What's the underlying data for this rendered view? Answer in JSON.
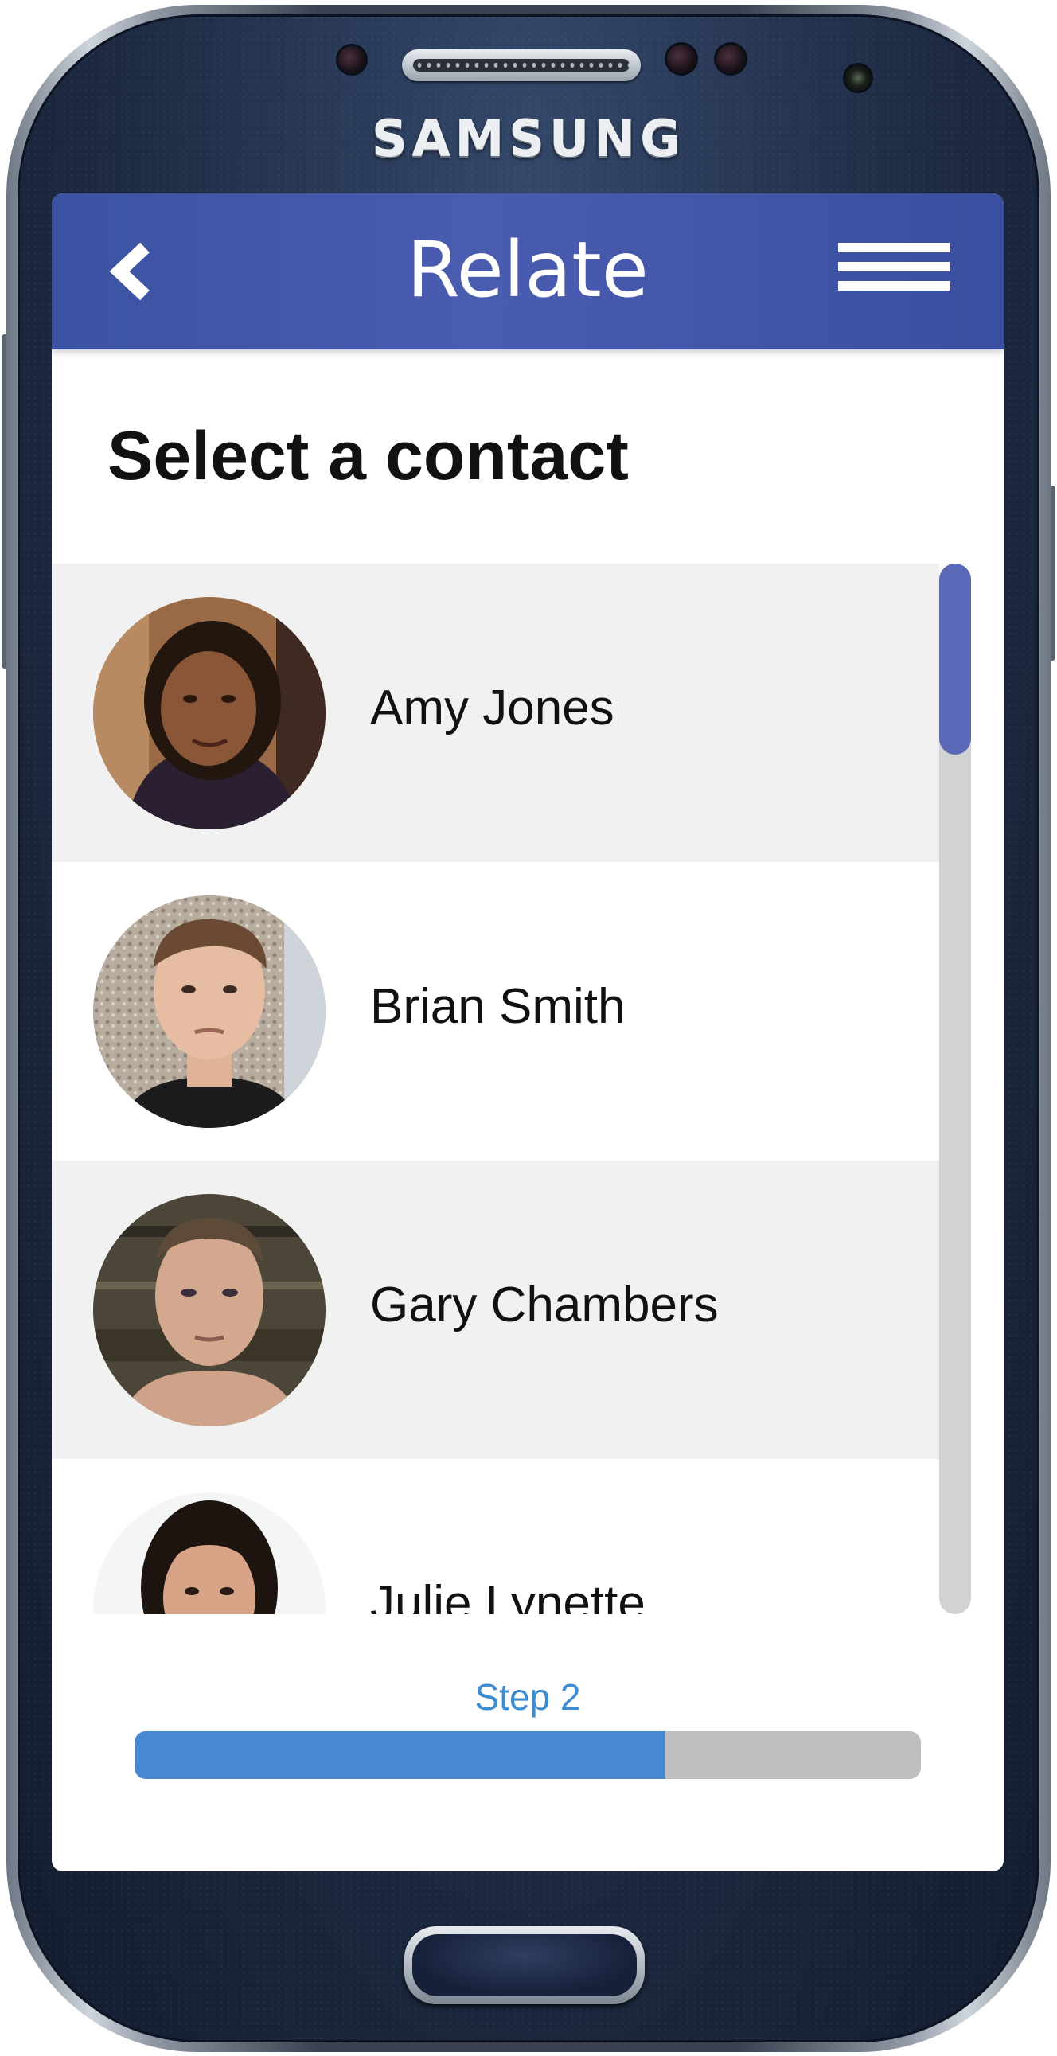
{
  "device": {
    "brand": "SAMSUNG"
  },
  "app": {
    "title": "Relate",
    "back_icon": "chevron-left-icon",
    "menu_icon": "hamburger-menu-icon",
    "accent_color": "#3f51a5"
  },
  "page": {
    "heading": "Select a contact"
  },
  "contacts": [
    {
      "name": "Amy Jones"
    },
    {
      "name": "Brian Smith"
    },
    {
      "name": "Gary Chambers"
    },
    {
      "name": "Julie Lynette"
    }
  ],
  "progress": {
    "label": "Step 2",
    "fraction": 0.675,
    "fill_color": "#4689d2",
    "track_color": "#bdbec0"
  }
}
